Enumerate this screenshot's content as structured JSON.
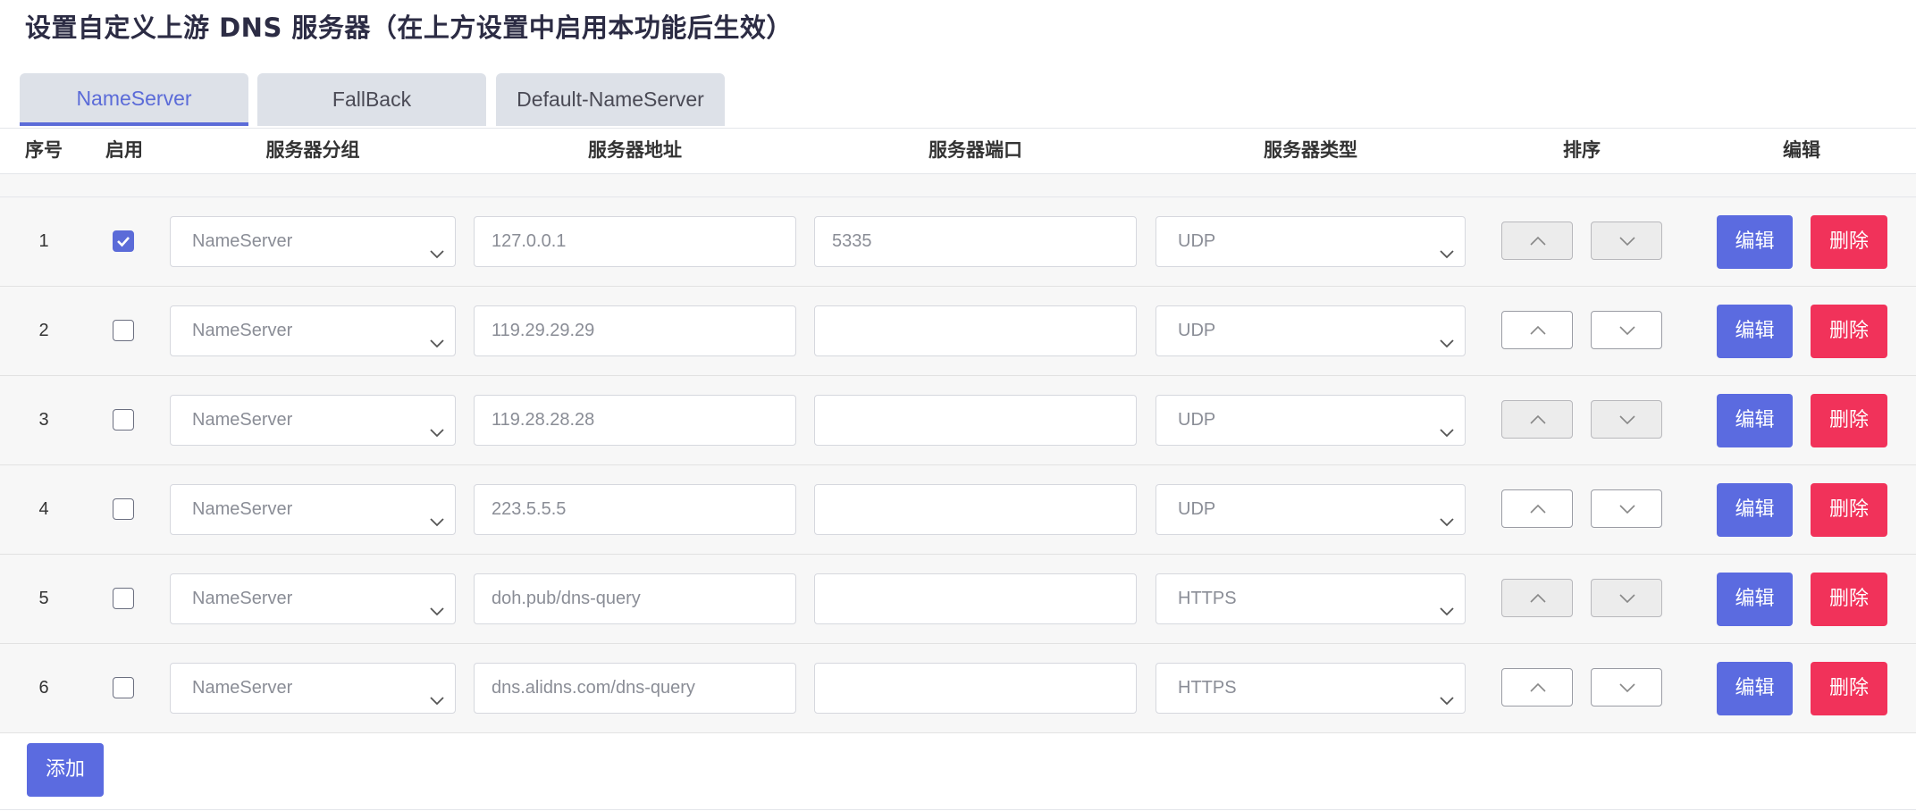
{
  "page_title": "设置自定义上游 DNS 服务器（在上方设置中启用本功能后生效）",
  "tabs": [
    {
      "label": "NameServer",
      "active": true
    },
    {
      "label": "FallBack",
      "active": false
    },
    {
      "label": "Default-NameServer",
      "active": false
    }
  ],
  "columns": {
    "index": "序号",
    "enabled": "启用",
    "group": "服务器分组",
    "address": "服务器地址",
    "port": "服务器端口",
    "type": "服务器类型",
    "sort": "排序",
    "edit": "编辑"
  },
  "rows": [
    {
      "index": "1",
      "enabled": true,
      "group": "NameServer",
      "address": "127.0.0.1",
      "port": "5335",
      "type": "UDP",
      "sort_dim": true
    },
    {
      "index": "2",
      "enabled": false,
      "group": "NameServer",
      "address": "119.29.29.29",
      "port": "",
      "type": "UDP",
      "sort_dim": false
    },
    {
      "index": "3",
      "enabled": false,
      "group": "NameServer",
      "address": "119.28.28.28",
      "port": "",
      "type": "UDP",
      "sort_dim": true
    },
    {
      "index": "4",
      "enabled": false,
      "group": "NameServer",
      "address": "223.5.5.5",
      "port": "",
      "type": "UDP",
      "sort_dim": false
    },
    {
      "index": "5",
      "enabled": false,
      "group": "NameServer",
      "address": "doh.pub/dns-query",
      "port": "",
      "type": "HTTPS",
      "sort_dim": true
    },
    {
      "index": "6",
      "enabled": false,
      "group": "NameServer",
      "address": "dns.alidns.com/dns-query",
      "port": "",
      "type": "HTTPS",
      "sort_dim": false
    }
  ],
  "row_actions": {
    "edit_label": "编辑",
    "delete_label": "删除"
  },
  "add_label": "添加",
  "colors": {
    "accent": "#5b6be0",
    "danger": "#f1325a",
    "tab_bg": "#dde1e8",
    "row_bg": "#f7f7f7"
  },
  "icons": {
    "checkbox_checked": "check-icon",
    "select_arrow": "chevron-down-icon",
    "sort_up": "chevron-up-icon",
    "sort_down": "chevron-down-icon"
  }
}
